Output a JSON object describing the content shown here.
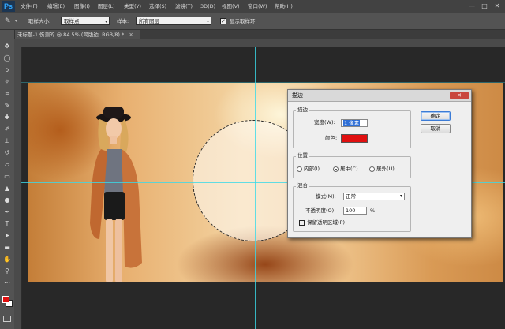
{
  "app": {
    "logo": "Ps",
    "menus": [
      "文件(F)",
      "编辑(E)",
      "图像(I)",
      "图层(L)",
      "类型(Y)",
      "选择(S)",
      "滤镜(T)",
      "3D(D)",
      "视图(V)",
      "窗口(W)",
      "帮助(H)"
    ],
    "window_controls": {
      "minimize": "—",
      "maximize": "□",
      "close": "✕"
    }
  },
  "options_bar": {
    "sample_size_label": "取样大小:",
    "sample_size_value": "取样点",
    "sample_label": "样本:",
    "sample_value": "所有图层",
    "show_ring_label": "显示取样环",
    "show_ring_checked": true
  },
  "document_tab": {
    "title": "未标题-1 伤测的 @ 84.5% (简版边, RGB/8) *",
    "close": "✕"
  },
  "dialog": {
    "title": "描边",
    "close_label": "✕",
    "stroke_group": {
      "label": "描边",
      "width_label": "宽度(W):",
      "width_value": "1 像素",
      "color_label": "颜色:",
      "color": "#e01010"
    },
    "position_group": {
      "label": "位置",
      "options": [
        "内部(I)",
        "居中(C)",
        "居外(U)"
      ],
      "selected": 1
    },
    "blend_group": {
      "label": "混合",
      "mode_label": "模式(M):",
      "mode_value": "正常",
      "opacity_label": "不透明度(O):",
      "opacity_value": "100",
      "opacity_unit": "%",
      "preserve_label": "保留透明区域(P)",
      "preserve_checked": false
    },
    "ok_label": "确定",
    "cancel_label": "取消"
  },
  "colors": {
    "foreground": "#e01010",
    "background": "#ffffff",
    "guide": "#39d9e8"
  },
  "tools": [
    "move-icon",
    "marquee-icon",
    "lasso-icon",
    "quick-select-icon",
    "crop-icon",
    "eyedropper-icon",
    "healing-icon",
    "brush-icon",
    "stamp-icon",
    "history-brush-icon",
    "eraser-icon",
    "gradient-icon",
    "blur-icon",
    "dodge-icon",
    "pen-icon",
    "type-icon",
    "path-select-icon",
    "shape-icon",
    "hand-icon",
    "zoom-icon"
  ]
}
